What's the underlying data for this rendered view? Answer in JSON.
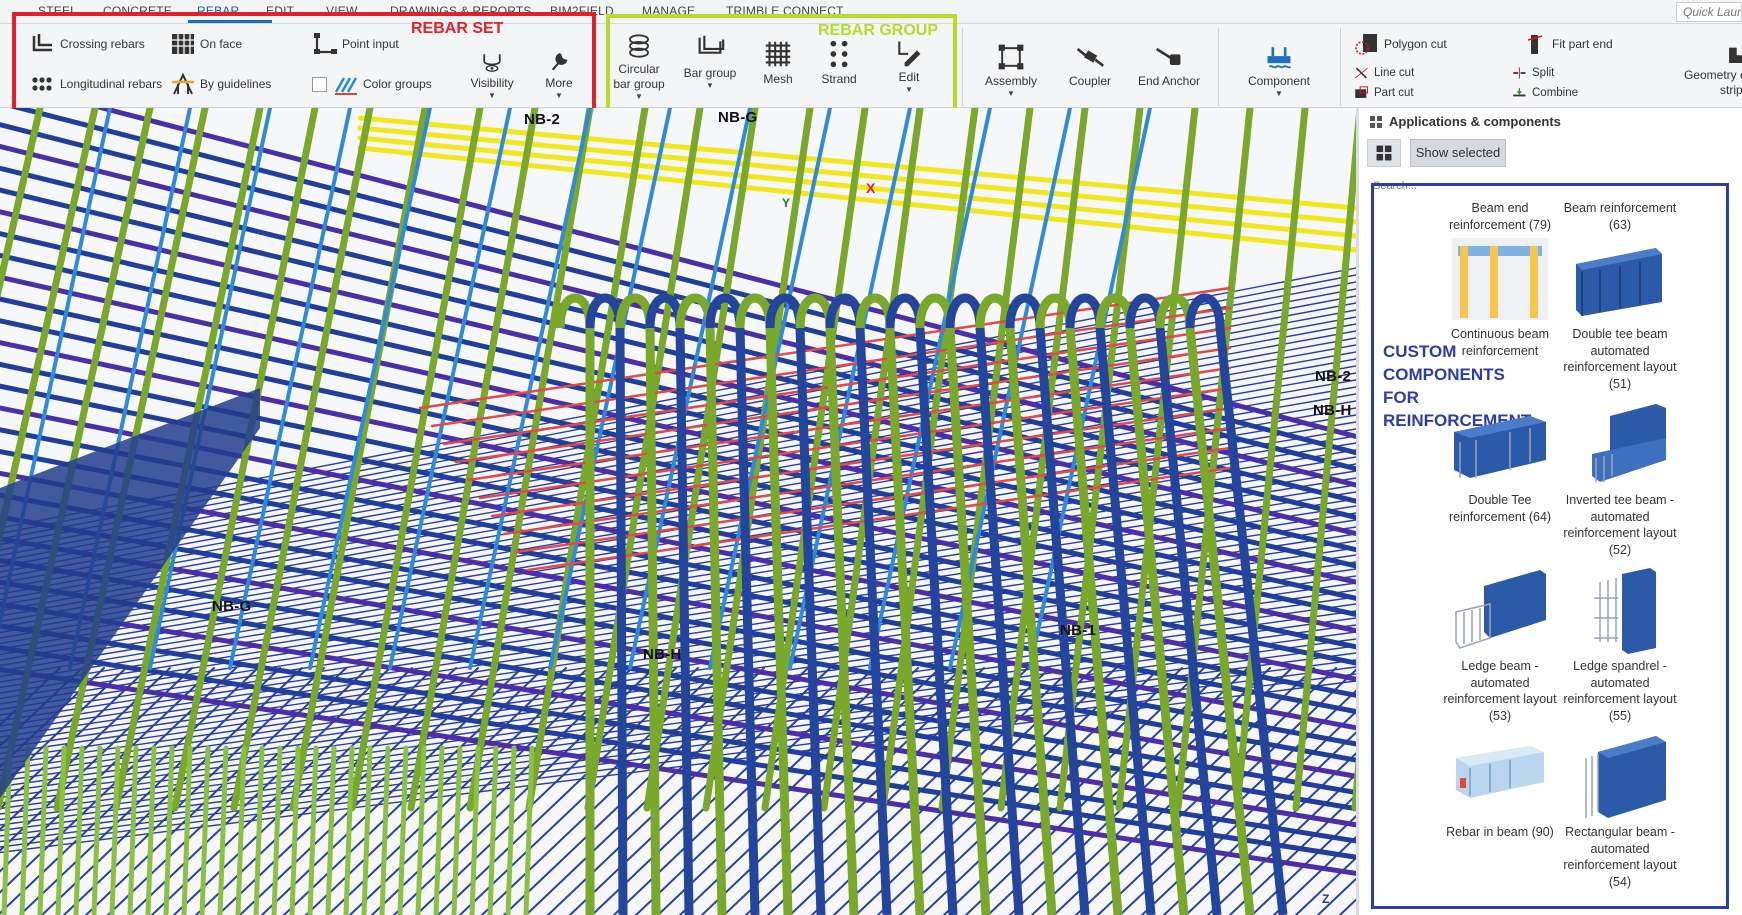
{
  "tabs": [
    {
      "label": "STEEL"
    },
    {
      "label": "CONCRETE"
    },
    {
      "label": "REBAR",
      "active": true
    },
    {
      "label": "EDIT"
    },
    {
      "label": "VIEW"
    },
    {
      "label": "DRAWINGS & REPORTS"
    },
    {
      "label": "BIM2FIELD"
    },
    {
      "label": "MANAGE"
    },
    {
      "label": "TRIMBLE CONNECT"
    }
  ],
  "quick_launch": {
    "placeholder": "Quick Launch"
  },
  "ribbon": {
    "rebar_set": {
      "annotation": "REBAR SET",
      "crossing_rebars": "Crossing rebars",
      "longitudinal_rebars": "Longitudinal rebars",
      "on_face": "On face",
      "by_guidelines": "By guidelines",
      "point_input": "Point input",
      "color_groups": "Color groups",
      "visibility": "Visibility",
      "more": "More"
    },
    "rebar_group": {
      "annotation": "REBAR GROUP",
      "circular_line1": "Circular",
      "circular_line2": "bar group",
      "bar_group": "Bar group",
      "mesh": "Mesh",
      "strand": "Strand",
      "edit": "Edit"
    },
    "assembly": "Assembly",
    "coupler": "Coupler",
    "end_anchor": "End Anchor",
    "component": "Component",
    "polygon_cut": "Polygon cut",
    "line_cut": "Line cut",
    "part_cut": "Part cut",
    "fit_part_end": "Fit part end",
    "split": "Split",
    "combine": "Combine",
    "geometry_line1": "Geometry e",
    "geometry_line2": "strip"
  },
  "colors": {
    "rebar_set_box": "#e3202a",
    "rebar_group_box": "#b5dc2a",
    "custom_box": "#2e3ca8",
    "accent": "#1e6fc2"
  },
  "viewport": {
    "grid_labels": [
      "NB-2",
      "NB-G",
      "NB-2",
      "NB-H",
      "NB-G",
      "NB-H",
      "NB-1"
    ],
    "axis_x": "X",
    "axis_y": "Y",
    "axis_z": "Z"
  },
  "panel": {
    "title": "Applications & components",
    "show_selected": "Show selected",
    "search_placeholder": "Search...",
    "custom_annotation_line1": "CUSTOM",
    "custom_annotation_line2": "COMPONENTS",
    "custom_annotation_line3": "FOR",
    "custom_annotation_line4": "REINFORCEMENT",
    "components": [
      {
        "name": "Beam end reinforcement (79)",
        "icon": "beam-end-icon"
      },
      {
        "name": "Beam reinforcement (63)",
        "icon": "beam-reinforcement-icon"
      },
      {
        "name": "Continuous beam reinforcement",
        "icon": "continuous-beam-icon"
      },
      {
        "name": "Double tee beam automated reinforcement layout (51)",
        "icon": "double-tee-auto-icon"
      },
      {
        "name": "Double Tee reinforcement (64)",
        "icon": "double-tee-icon"
      },
      {
        "name": "Inverted tee beam - automated reinforcement layout (52)",
        "icon": "inverted-tee-icon"
      },
      {
        "name": "Ledge beam - automated reinforcement layout (53)",
        "icon": "ledge-beam-icon"
      },
      {
        "name": "Ledge spandrel - automated reinforcement layout (55)",
        "icon": "ledge-spandrel-icon"
      },
      {
        "name": "Rebar in beam (90)",
        "icon": "rebar-in-beam-icon"
      },
      {
        "name": "Rectangular beam - automated reinforcement layout (54)",
        "icon": "rectangular-beam-icon"
      }
    ]
  }
}
